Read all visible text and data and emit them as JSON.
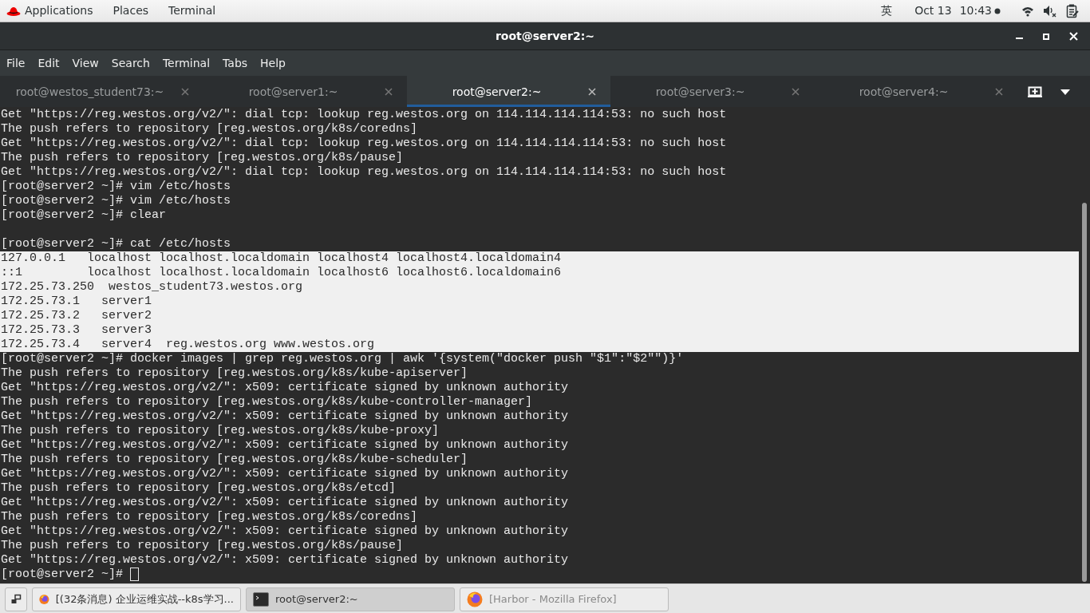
{
  "top_bar": {
    "menus": [
      "Applications",
      "Places",
      "Terminal"
    ],
    "input_method": "英",
    "date": "Oct 13",
    "time": "10:43"
  },
  "window": {
    "title": "root@server2:~"
  },
  "menu_bar": [
    "File",
    "Edit",
    "View",
    "Search",
    "Terminal",
    "Tabs",
    "Help"
  ],
  "tabs": [
    {
      "label": "root@westos_student73:~",
      "selected": false
    },
    {
      "label": "root@server1:~",
      "selected": false
    },
    {
      "label": "root@server2:~",
      "selected": true
    },
    {
      "label": "root@server3:~",
      "selected": false
    },
    {
      "label": "root@server4:~",
      "selected": false
    }
  ],
  "terminal": {
    "lines": [
      {
        "kind": "text",
        "text": "Get \"https://reg.westos.org/v2/\": dial tcp: lookup reg.westos.org on 114.114.114.114:53: no such host",
        "selected": false
      },
      {
        "kind": "text",
        "text": "The push refers to repository [reg.westos.org/k8s/coredns]",
        "selected": false
      },
      {
        "kind": "text",
        "text": "Get \"https://reg.westos.org/v2/\": dial tcp: lookup reg.westos.org on 114.114.114.114:53: no such host",
        "selected": false
      },
      {
        "kind": "text",
        "text": "The push refers to repository [reg.westos.org/k8s/pause]",
        "selected": false
      },
      {
        "kind": "text",
        "text": "Get \"https://reg.westos.org/v2/\": dial tcp: lookup reg.westos.org on 114.114.114.114:53: no such host",
        "selected": false
      },
      {
        "kind": "text",
        "text": "[root@server2 ~]# vim /etc/hosts",
        "selected": false
      },
      {
        "kind": "text",
        "text": "[root@server2 ~]# vim /etc/hosts",
        "selected": false
      },
      {
        "kind": "text",
        "text": "[root@server2 ~]# clear",
        "selected": false
      },
      {
        "kind": "blank",
        "selected": false
      },
      {
        "kind": "text",
        "text": "[root@server2 ~]# cat /etc/hosts",
        "selected": false
      },
      {
        "kind": "text",
        "text": "127.0.0.1   localhost localhost.localdomain localhost4 localhost4.localdomain4",
        "selected": true
      },
      {
        "kind": "text",
        "text": "::1         localhost localhost.localdomain localhost6 localhost6.localdomain6",
        "selected": true
      },
      {
        "kind": "text",
        "text": "172.25.73.250  westos_student73.westos.org",
        "selected": true
      },
      {
        "kind": "text",
        "text": "172.25.73.1   server1",
        "selected": true
      },
      {
        "kind": "text",
        "text": "172.25.73.2   server2",
        "selected": true
      },
      {
        "kind": "text",
        "text": "172.25.73.3   server3",
        "selected": true
      },
      {
        "kind": "text",
        "text": "172.25.73.4   server4  reg.westos.org www.westos.org",
        "selected": true
      },
      {
        "kind": "text",
        "text": "[root@server2 ~]# docker images | grep reg.westos.org | awk '{system(\"docker push \"$1\":\"$2\"\")}'",
        "selected": false
      },
      {
        "kind": "text",
        "text": "The push refers to repository [reg.westos.org/k8s/kube-apiserver]",
        "selected": false
      },
      {
        "kind": "text",
        "text": "Get \"https://reg.westos.org/v2/\": x509: certificate signed by unknown authority",
        "selected": false
      },
      {
        "kind": "text",
        "text": "The push refers to repository [reg.westos.org/k8s/kube-controller-manager]",
        "selected": false
      },
      {
        "kind": "text",
        "text": "Get \"https://reg.westos.org/v2/\": x509: certificate signed by unknown authority",
        "selected": false
      },
      {
        "kind": "text",
        "text": "The push refers to repository [reg.westos.org/k8s/kube-proxy]",
        "selected": false
      },
      {
        "kind": "text",
        "text": "Get \"https://reg.westos.org/v2/\": x509: certificate signed by unknown authority",
        "selected": false
      },
      {
        "kind": "text",
        "text": "The push refers to repository [reg.westos.org/k8s/kube-scheduler]",
        "selected": false
      },
      {
        "kind": "text",
        "text": "Get \"https://reg.westos.org/v2/\": x509: certificate signed by unknown authority",
        "selected": false
      },
      {
        "kind": "text",
        "text": "The push refers to repository [reg.westos.org/k8s/etcd]",
        "selected": false
      },
      {
        "kind": "text",
        "text": "Get \"https://reg.westos.org/v2/\": x509: certificate signed by unknown authority",
        "selected": false
      },
      {
        "kind": "text",
        "text": "The push refers to repository [reg.westos.org/k8s/coredns]",
        "selected": false
      },
      {
        "kind": "text",
        "text": "Get \"https://reg.westos.org/v2/\": x509: certificate signed by unknown authority",
        "selected": false
      },
      {
        "kind": "text",
        "text": "The push refers to repository [reg.westos.org/k8s/pause]",
        "selected": false
      },
      {
        "kind": "text",
        "text": "Get \"https://reg.westos.org/v2/\": x509: certificate signed by unknown authority",
        "selected": false
      },
      {
        "kind": "prompt",
        "text": "[root@server2 ~]#",
        "selected": false
      }
    ]
  },
  "taskbar": [
    {
      "kind": "firefox",
      "label": "[(32条消息) 企业运维实战--k8s学习...",
      "selected": false,
      "minimized": false
    },
    {
      "kind": "terminal",
      "label": "root@server2:~",
      "selected": true,
      "minimized": false
    },
    {
      "kind": "firefox",
      "label": "[Harbor - Mozilla Firefox]",
      "selected": false,
      "minimized": true
    }
  ]
}
